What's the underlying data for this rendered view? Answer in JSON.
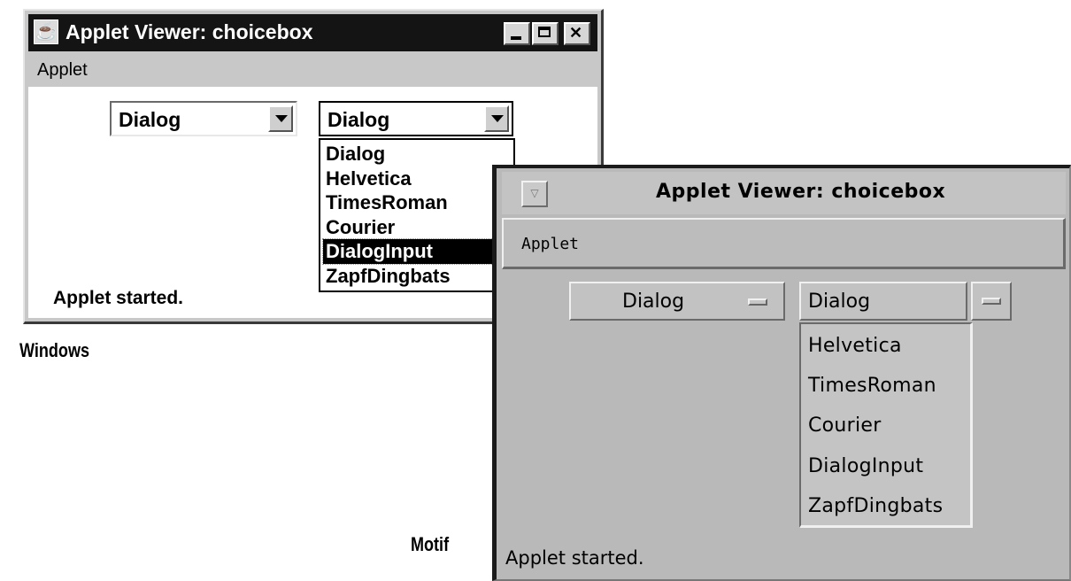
{
  "windows_window": {
    "title": "Applet Viewer: choicebox",
    "menu": [
      "Applet"
    ],
    "choice1": {
      "value": "Dialog"
    },
    "choice2": {
      "value": "Dialog"
    },
    "dropdown_items": [
      "Dialog",
      "Helvetica",
      "TimesRoman",
      "Courier",
      "DialogInput",
      "ZapfDingbats"
    ],
    "highlighted_item": "DialogInput",
    "status": "Applet started."
  },
  "captions": {
    "windows": "Windows",
    "motif": "Motif"
  },
  "motif_window": {
    "title": "Applet Viewer: choicebox",
    "menu": [
      "Applet"
    ],
    "choice1": {
      "value": "Dialog"
    },
    "choice2": {
      "value": "Dialog"
    },
    "dropdown_items": [
      "Helvetica",
      "TimesRoman",
      "Courier",
      "DialogInput",
      "ZapfDingbats"
    ],
    "status": "Applet started."
  },
  "icons": {
    "windows_app_icon": "java-applet-icon",
    "minimize": "minimize-icon",
    "maximize": "maximize-icon",
    "close": "close-icon",
    "motif_window_menu": "window-menu-icon"
  }
}
